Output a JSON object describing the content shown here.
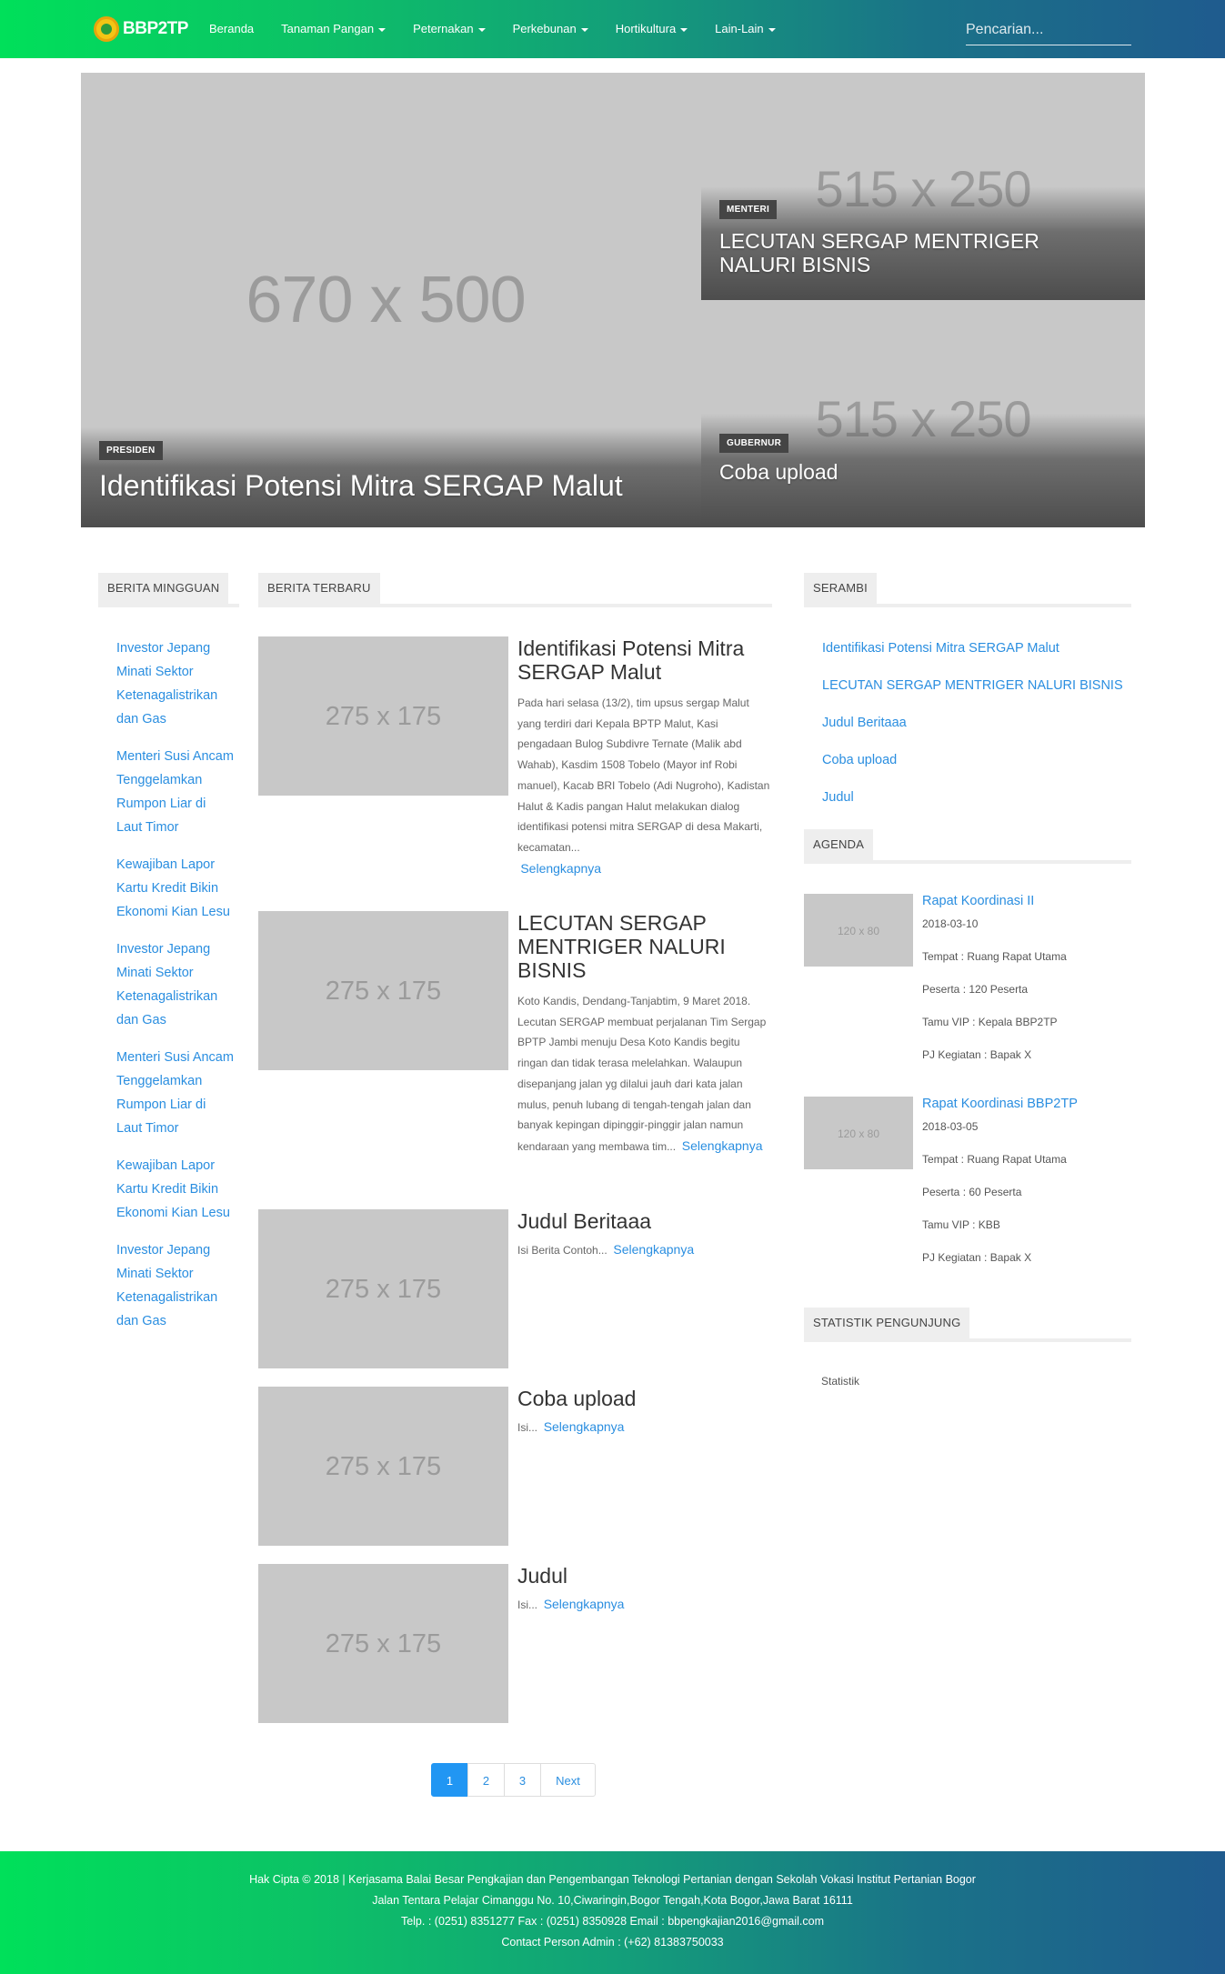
{
  "brand": {
    "name": "BBP2TP"
  },
  "nav": {
    "items": [
      {
        "label": "Beranda",
        "dropdown": false
      },
      {
        "label": "Tanaman Pangan",
        "dropdown": true
      },
      {
        "label": "Peternakan",
        "dropdown": true
      },
      {
        "label": "Perkebunan",
        "dropdown": true
      },
      {
        "label": "Hortikultura",
        "dropdown": true
      },
      {
        "label": "Lain-Lain",
        "dropdown": true
      }
    ],
    "search_placeholder": "Pencarian..."
  },
  "hero": {
    "main": {
      "placeholder": "670 x 500",
      "tag": "PRESIDEN",
      "title": "Identifikasi Potensi Mitra SERGAP Malut"
    },
    "side": [
      {
        "placeholder": "515 x 250",
        "tag": "MENTERI",
        "title": "LECUTAN SERGAP MENTRIGER NALURI BISNIS"
      },
      {
        "placeholder": "515 x 250",
        "tag": "GUBERNUR",
        "title": "Coba upload"
      }
    ]
  },
  "left": {
    "heading": "BERITA MINGGUAN",
    "items": [
      "Investor Jepang Minati Sektor Ketenagalistrikan dan Gas",
      "Menteri Susi Ancam Tenggelamkan Rumpon Liar di Laut Timor",
      "Kewajiban Lapor Kartu Kredit Bikin Ekonomi Kian Lesu",
      "Investor Jepang Minati Sektor Ketenagalistrikan dan Gas",
      "Menteri Susi Ancam Tenggelamkan Rumpon Liar di Laut Timor",
      "Kewajiban Lapor Kartu Kredit Bikin Ekonomi Kian Lesu",
      "Investor Jepang Minati Sektor Ketenagalistrikan dan Gas"
    ]
  },
  "center": {
    "heading": "BERITA TERBARU",
    "more_label": "Selengkapnya",
    "articles": [
      {
        "placeholder": "275 x 175",
        "title": "Identifikasi Potensi Mitra SERGAP Malut",
        "excerpt": "Pada hari selasa (13/2), tim upsus sergap Malut yang terdiri dari Kepala BPTP Malut, Kasi pengadaan Bulog Subdivre Ternate (Malik abd Wahab), Kasdim 1508 Tobelo (Mayor inf Robi manuel), Kacab BRI Tobelo (Adi Nugroho), Kadistan Halut & Kadis pangan Halut melakukan dialog identifikasi potensi mitra SERGAP di desa Makarti, kecamatan..."
      },
      {
        "placeholder": "275 x 175",
        "title": "LECUTAN SERGAP MENTRIGER NALURI BISNIS",
        "excerpt": "Koto Kandis, Dendang-Tanjabtim, 9 Maret 2018. Lecutan SERGAP membuat perjalanan Tim Sergap BPTP Jambi menuju Desa Koto Kandis begitu ringan dan tidak terasa melelahkan. Walaupun disepanjang jalan yg dilalui jauh dari kata jalan mulus, penuh lubang di tengah-tengah jalan dan banyak kepingan dipinggir-pinggir jalan namun kendaraan yang membawa tim..."
      },
      {
        "placeholder": "275 x 175",
        "title": "Judul Beritaaa",
        "excerpt": "Isi Berita Contoh..."
      },
      {
        "placeholder": "275 x 175",
        "title": "Coba upload",
        "excerpt": "Isi..."
      },
      {
        "placeholder": "275 x 175",
        "title": "Judul",
        "excerpt": "Isi..."
      }
    ]
  },
  "pagination": {
    "pages": [
      "1",
      "2",
      "3"
    ],
    "active": "1",
    "next": "Next"
  },
  "right": {
    "serambi": {
      "heading": "SERAMBI",
      "items": [
        "Identifikasi Potensi Mitra SERGAP Malut",
        "LECUTAN SERGAP MENTRIGER NALURI BISNIS",
        "Judul Beritaaa",
        "Coba upload",
        "Judul"
      ]
    },
    "agenda": {
      "heading": "AGENDA",
      "items": [
        {
          "placeholder": "120 x 80",
          "title": "Rapat Koordinasi II",
          "date": "2018-03-10",
          "tempat": "Tempat : Ruang Rapat Utama",
          "peserta": "Peserta : 120 Peserta",
          "tamu": "Tamu VIP : Kepala BBP2TP",
          "pj": "PJ Kegiatan : Bapak X"
        },
        {
          "placeholder": "120 x 80",
          "title": "Rapat Koordinasi BBP2TP",
          "date": "2018-03-05",
          "tempat": "Tempat : Ruang Rapat Utama",
          "peserta": "Peserta : 60 Peserta",
          "tamu": "Tamu VIP : KBB",
          "pj": "PJ Kegiatan : Bapak X"
        }
      ]
    },
    "statistik": {
      "heading": "STATISTIK PENGUNJUNG",
      "text": "Statistik"
    }
  },
  "footer": {
    "line1": "Hak Cipta © 2018 | Kerjasama Balai Besar Pengkajian dan Pengembangan Teknologi Pertanian dengan Sekolah Vokasi Institut Pertanian Bogor",
    "line2": "Jalan Tentara Pelajar Cimanggu No. 10,Ciwaringin,Bogor Tengah,Kota Bogor,Jawa Barat 16111",
    "line3": "Telp. : (0251) 8351277 Fax : (0251) 8350928 Email : bbpengkajian2016@gmail.com",
    "line4": "Contact Person Admin : (+62) 81383750033"
  },
  "colors": {
    "navbar_start": "#00e05a",
    "navbar_end": "#1f5b8e",
    "link": "#2a8ee0",
    "pagination_active": "#2196f3",
    "placeholder_bg": "#c8c8c8"
  }
}
